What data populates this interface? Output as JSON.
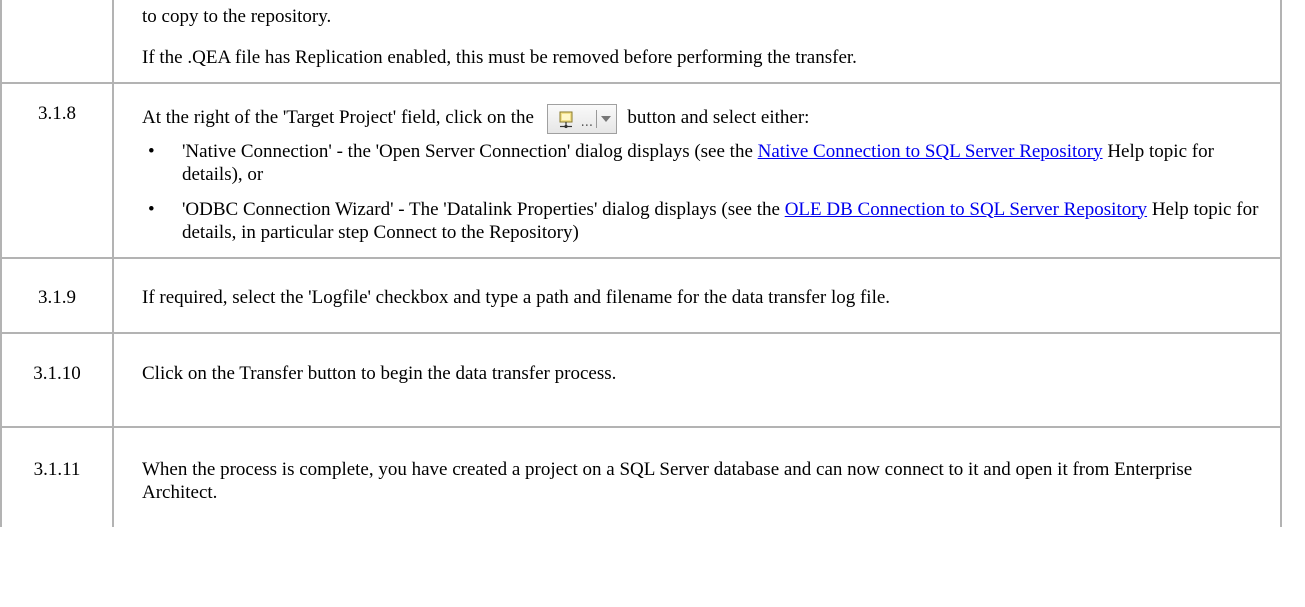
{
  "rows": [
    {
      "step": "",
      "lines": [
        "to copy to the repository.",
        "If the .QEA file has Replication enabled, this must be removed before performing the transfer."
      ]
    },
    {
      "step": "3.1.8",
      "intro_before": "At the right of the 'Target Project' field, click on the",
      "intro_after": "button and select either:",
      "button_icon": "database-connection-icon",
      "button_dots": "...",
      "bullets": [
        {
          "before": "'Native Connection' - the 'Open Server Connection' dialog displays (see the ",
          "link": "Native Connection to SQL Server Repository",
          "after": " Help topic for details), or"
        },
        {
          "before": "'ODBC Connection Wizard' - The 'Datalink Properties' dialog displays (see the ",
          "link": "OLE DB Connection to SQL Server Repository",
          "after": " Help topic for details, in particular step Connect to the Repository)"
        }
      ]
    },
    {
      "step": "3.1.9",
      "text": "If required, select the 'Logfile' checkbox and type a path and filename for the data transfer log file."
    },
    {
      "step": "3.1.10",
      "text": "Click on the Transfer button to begin the data transfer process."
    },
    {
      "step": "3.1.11",
      "text": "When the process is complete, you have created a project on a SQL Server database and can now connect to it and open it from Enterprise Architect."
    }
  ],
  "bullet_glyph": "•",
  "colors": {
    "link": "#0000ee",
    "border": "#b3b3b3"
  }
}
